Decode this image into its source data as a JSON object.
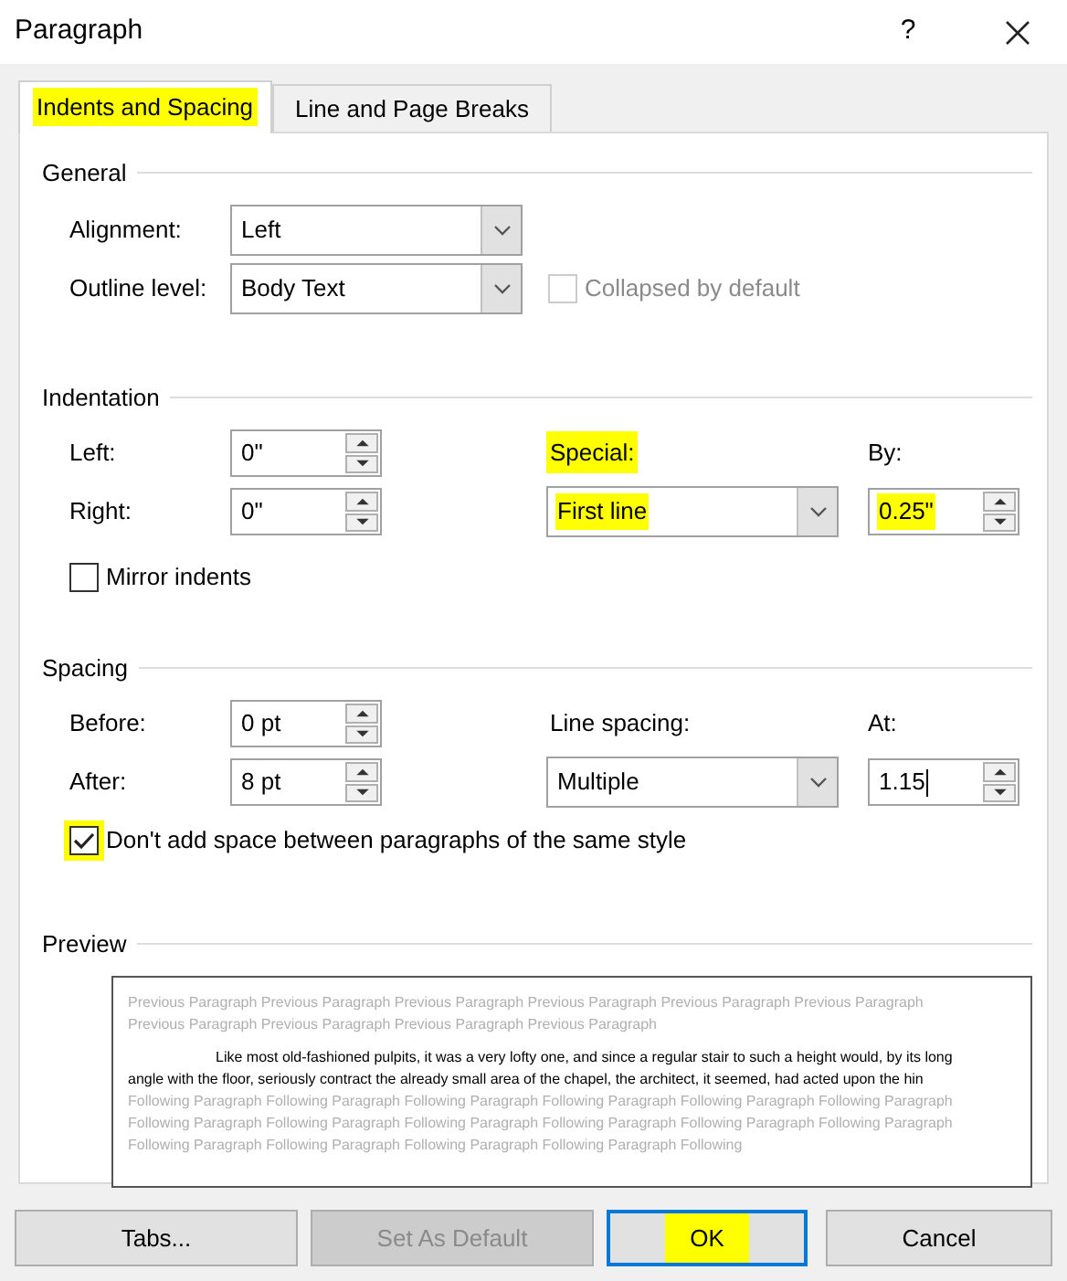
{
  "window": {
    "title": "Paragraph",
    "help": "?"
  },
  "tabs": [
    {
      "label": "Indents and Spacing",
      "selected": true,
      "highlighted": true
    },
    {
      "label": "Line and Page Breaks",
      "selected": false,
      "highlighted": false
    }
  ],
  "general": {
    "heading": "General",
    "alignment": {
      "label": "Alignment:",
      "value": "Left"
    },
    "outline_level": {
      "label": "Outline level:",
      "value": "Body Text"
    },
    "collapsed": {
      "label": "Collapsed by default",
      "checked": false,
      "disabled": true
    }
  },
  "indentation": {
    "heading": "Indentation",
    "left": {
      "label": "Left:",
      "value": "0\""
    },
    "right": {
      "label": "Right:",
      "value": "0\""
    },
    "special": {
      "label": "Special:",
      "label_highlighted": true,
      "value": "First line",
      "value_highlighted": true
    },
    "by": {
      "label": "By:",
      "value": "0.25\"",
      "value_highlighted": true
    },
    "mirror": {
      "label": "Mirror indents",
      "checked": false,
      "highlighted": false
    }
  },
  "spacing": {
    "heading": "Spacing",
    "before": {
      "label": "Before:",
      "value": "0 pt"
    },
    "after": {
      "label": "After:",
      "value": "8 pt"
    },
    "line_spacing": {
      "label": "Line spacing:",
      "label_highlighted": false,
      "value": "Multiple",
      "value_highlighted": false
    },
    "at": {
      "label": "At:",
      "value": "1.15",
      "value_highlighted": false
    },
    "dont_add": {
      "label": "Don't add space between paragraphs of the same style",
      "checked": true,
      "highlighted": true
    }
  },
  "preview": {
    "heading": "Preview",
    "previous": "Previous Paragraph Previous Paragraph Previous Paragraph Previous Paragraph Previous Paragraph Previous Paragraph Previous Paragraph Previous Paragraph Previous Paragraph Previous Paragraph",
    "sample": "Like most old-fashioned pulpits, it was a very lofty one, and since a regular stair to such a height would, by its long angle with the floor, seriously contract the already small area of the chapel, the architect, it seemed, had acted upon the hin",
    "following": "Following Paragraph Following Paragraph Following Paragraph Following Paragraph Following Paragraph Following Paragraph Following Paragraph Following Paragraph Following Paragraph Following Paragraph Following Paragraph Following Paragraph Following Paragraph Following Paragraph Following Paragraph Following Paragraph Following"
  },
  "buttons": [
    {
      "label": "Tabs...",
      "disabled": false,
      "highlighted": false,
      "default": false
    },
    {
      "label": "Set As Default",
      "disabled": true,
      "highlighted": false,
      "default": false
    },
    {
      "label": "OK",
      "disabled": false,
      "highlighted": true,
      "default": true
    },
    {
      "label": "Cancel",
      "disabled": false,
      "highlighted": false,
      "default": false
    }
  ]
}
